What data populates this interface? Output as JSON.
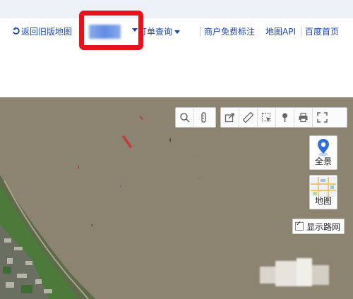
{
  "navbar": {
    "back_link": "返回旧版地图",
    "blurred_text": "",
    "order_query": "订单查询",
    "merchant_label": "商户免费标注",
    "map_api": "地图API",
    "baidu_home": "百度首页"
  },
  "map_controls": {
    "panorama_label": "全景",
    "map_type_label": "地图",
    "road_network_label": "显示路网",
    "road_network_checked": true
  },
  "colors": {
    "link_blue": "#1a43b8",
    "highlight_red": "#e5131b",
    "water": "#8d8470",
    "vegetation": "#4b7a3b"
  },
  "icons": [
    "return-arrow-icon",
    "caret-down-icon",
    "magnifier-icon",
    "ruler-vertical-icon",
    "share-icon",
    "measure-icon",
    "screenshot-icon",
    "pin-icon",
    "print-icon",
    "fullscreen-icon",
    "location-pin-icon"
  ]
}
